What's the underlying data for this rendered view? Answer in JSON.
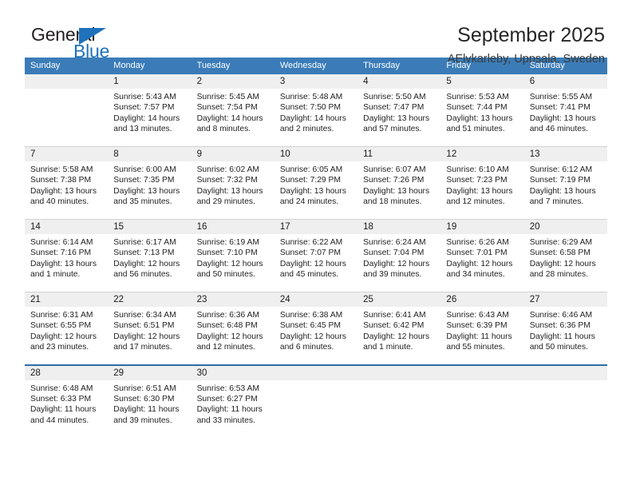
{
  "brand": {
    "word_one": "General",
    "word_two": "Blue",
    "accent_color": "#1f72bb",
    "triangle_icon": "brand-triangle-icon"
  },
  "header": {
    "title": "September 2025",
    "subtitle": "AElvkarleby, Uppsala, Sweden"
  },
  "calendar": {
    "header_bg": "#3b7cb8",
    "datebar_bg": "#efefef",
    "weekdays": [
      "Sunday",
      "Monday",
      "Tuesday",
      "Wednesday",
      "Thursday",
      "Friday",
      "Saturday"
    ],
    "weeks": [
      [
        {
          "day": "",
          "sunrise": "",
          "sunset": "",
          "daylight_1": "",
          "daylight_2": ""
        },
        {
          "day": "1",
          "sunrise": "Sunrise: 5:43 AM",
          "sunset": "Sunset: 7:57 PM",
          "daylight_1": "Daylight: 14 hours",
          "daylight_2": "and 13 minutes."
        },
        {
          "day": "2",
          "sunrise": "Sunrise: 5:45 AM",
          "sunset": "Sunset: 7:54 PM",
          "daylight_1": "Daylight: 14 hours",
          "daylight_2": "and 8 minutes."
        },
        {
          "day": "3",
          "sunrise": "Sunrise: 5:48 AM",
          "sunset": "Sunset: 7:50 PM",
          "daylight_1": "Daylight: 14 hours",
          "daylight_2": "and 2 minutes."
        },
        {
          "day": "4",
          "sunrise": "Sunrise: 5:50 AM",
          "sunset": "Sunset: 7:47 PM",
          "daylight_1": "Daylight: 13 hours",
          "daylight_2": "and 57 minutes."
        },
        {
          "day": "5",
          "sunrise": "Sunrise: 5:53 AM",
          "sunset": "Sunset: 7:44 PM",
          "daylight_1": "Daylight: 13 hours",
          "daylight_2": "and 51 minutes."
        },
        {
          "day": "6",
          "sunrise": "Sunrise: 5:55 AM",
          "sunset": "Sunset: 7:41 PM",
          "daylight_1": "Daylight: 13 hours",
          "daylight_2": "and 46 minutes."
        }
      ],
      [
        {
          "day": "7",
          "sunrise": "Sunrise: 5:58 AM",
          "sunset": "Sunset: 7:38 PM",
          "daylight_1": "Daylight: 13 hours",
          "daylight_2": "and 40 minutes."
        },
        {
          "day": "8",
          "sunrise": "Sunrise: 6:00 AM",
          "sunset": "Sunset: 7:35 PM",
          "daylight_1": "Daylight: 13 hours",
          "daylight_2": "and 35 minutes."
        },
        {
          "day": "9",
          "sunrise": "Sunrise: 6:02 AM",
          "sunset": "Sunset: 7:32 PM",
          "daylight_1": "Daylight: 13 hours",
          "daylight_2": "and 29 minutes."
        },
        {
          "day": "10",
          "sunrise": "Sunrise: 6:05 AM",
          "sunset": "Sunset: 7:29 PM",
          "daylight_1": "Daylight: 13 hours",
          "daylight_2": "and 24 minutes."
        },
        {
          "day": "11",
          "sunrise": "Sunrise: 6:07 AM",
          "sunset": "Sunset: 7:26 PM",
          "daylight_1": "Daylight: 13 hours",
          "daylight_2": "and 18 minutes."
        },
        {
          "day": "12",
          "sunrise": "Sunrise: 6:10 AM",
          "sunset": "Sunset: 7:23 PM",
          "daylight_1": "Daylight: 13 hours",
          "daylight_2": "and 12 minutes."
        },
        {
          "day": "13",
          "sunrise": "Sunrise: 6:12 AM",
          "sunset": "Sunset: 7:19 PM",
          "daylight_1": "Daylight: 13 hours",
          "daylight_2": "and 7 minutes."
        }
      ],
      [
        {
          "day": "14",
          "sunrise": "Sunrise: 6:14 AM",
          "sunset": "Sunset: 7:16 PM",
          "daylight_1": "Daylight: 13 hours",
          "daylight_2": "and 1 minute."
        },
        {
          "day": "15",
          "sunrise": "Sunrise: 6:17 AM",
          "sunset": "Sunset: 7:13 PM",
          "daylight_1": "Daylight: 12 hours",
          "daylight_2": "and 56 minutes."
        },
        {
          "day": "16",
          "sunrise": "Sunrise: 6:19 AM",
          "sunset": "Sunset: 7:10 PM",
          "daylight_1": "Daylight: 12 hours",
          "daylight_2": "and 50 minutes."
        },
        {
          "day": "17",
          "sunrise": "Sunrise: 6:22 AM",
          "sunset": "Sunset: 7:07 PM",
          "daylight_1": "Daylight: 12 hours",
          "daylight_2": "and 45 minutes."
        },
        {
          "day": "18",
          "sunrise": "Sunrise: 6:24 AM",
          "sunset": "Sunset: 7:04 PM",
          "daylight_1": "Daylight: 12 hours",
          "daylight_2": "and 39 minutes."
        },
        {
          "day": "19",
          "sunrise": "Sunrise: 6:26 AM",
          "sunset": "Sunset: 7:01 PM",
          "daylight_1": "Daylight: 12 hours",
          "daylight_2": "and 34 minutes."
        },
        {
          "day": "20",
          "sunrise": "Sunrise: 6:29 AM",
          "sunset": "Sunset: 6:58 PM",
          "daylight_1": "Daylight: 12 hours",
          "daylight_2": "and 28 minutes."
        }
      ],
      [
        {
          "day": "21",
          "sunrise": "Sunrise: 6:31 AM",
          "sunset": "Sunset: 6:55 PM",
          "daylight_1": "Daylight: 12 hours",
          "daylight_2": "and 23 minutes."
        },
        {
          "day": "22",
          "sunrise": "Sunrise: 6:34 AM",
          "sunset": "Sunset: 6:51 PM",
          "daylight_1": "Daylight: 12 hours",
          "daylight_2": "and 17 minutes."
        },
        {
          "day": "23",
          "sunrise": "Sunrise: 6:36 AM",
          "sunset": "Sunset: 6:48 PM",
          "daylight_1": "Daylight: 12 hours",
          "daylight_2": "and 12 minutes."
        },
        {
          "day": "24",
          "sunrise": "Sunrise: 6:38 AM",
          "sunset": "Sunset: 6:45 PM",
          "daylight_1": "Daylight: 12 hours",
          "daylight_2": "and 6 minutes."
        },
        {
          "day": "25",
          "sunrise": "Sunrise: 6:41 AM",
          "sunset": "Sunset: 6:42 PM",
          "daylight_1": "Daylight: 12 hours",
          "daylight_2": "and 1 minute."
        },
        {
          "day": "26",
          "sunrise": "Sunrise: 6:43 AM",
          "sunset": "Sunset: 6:39 PM",
          "daylight_1": "Daylight: 11 hours",
          "daylight_2": "and 55 minutes."
        },
        {
          "day": "27",
          "sunrise": "Sunrise: 6:46 AM",
          "sunset": "Sunset: 6:36 PM",
          "daylight_1": "Daylight: 11 hours",
          "daylight_2": "and 50 minutes."
        }
      ],
      [
        {
          "day": "28",
          "sunrise": "Sunrise: 6:48 AM",
          "sunset": "Sunset: 6:33 PM",
          "daylight_1": "Daylight: 11 hours",
          "daylight_2": "and 44 minutes."
        },
        {
          "day": "29",
          "sunrise": "Sunrise: 6:51 AM",
          "sunset": "Sunset: 6:30 PM",
          "daylight_1": "Daylight: 11 hours",
          "daylight_2": "and 39 minutes."
        },
        {
          "day": "30",
          "sunrise": "Sunrise: 6:53 AM",
          "sunset": "Sunset: 6:27 PM",
          "daylight_1": "Daylight: 11 hours",
          "daylight_2": "and 33 minutes."
        },
        {
          "day": "",
          "sunrise": "",
          "sunset": "",
          "daylight_1": "",
          "daylight_2": ""
        },
        {
          "day": "",
          "sunrise": "",
          "sunset": "",
          "daylight_1": "",
          "daylight_2": ""
        },
        {
          "day": "",
          "sunrise": "",
          "sunset": "",
          "daylight_1": "",
          "daylight_2": ""
        },
        {
          "day": "",
          "sunrise": "",
          "sunset": "",
          "daylight_1": "",
          "daylight_2": ""
        }
      ]
    ]
  }
}
